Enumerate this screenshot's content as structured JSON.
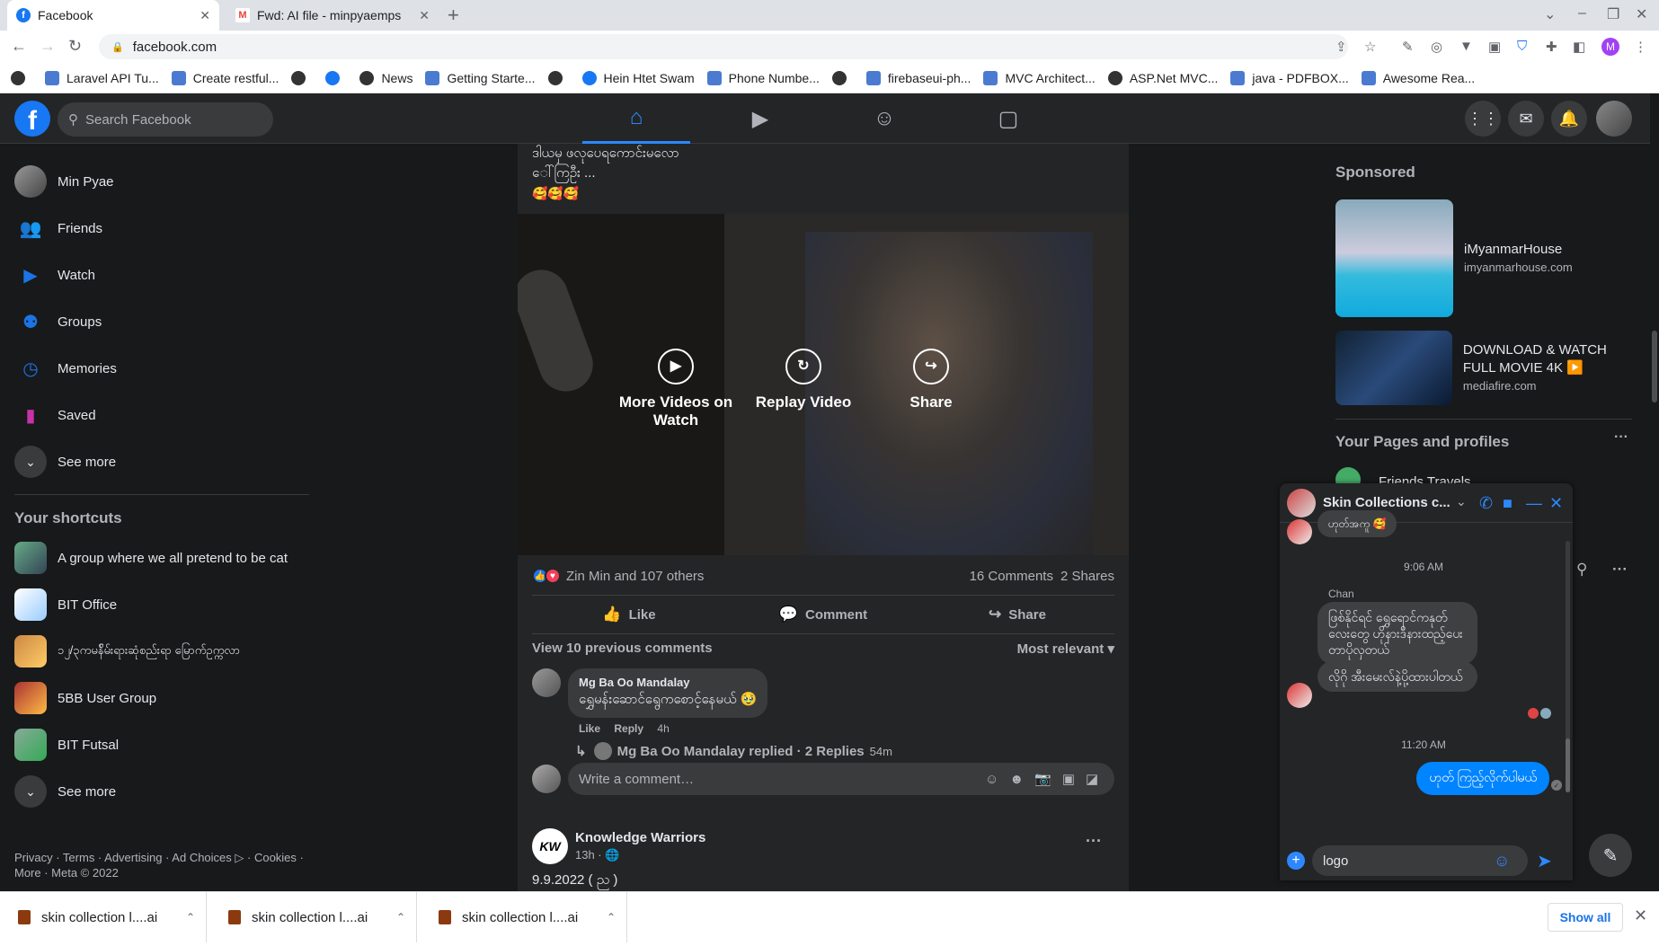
{
  "browser": {
    "tabs": [
      {
        "title": "Facebook",
        "active": true
      },
      {
        "title": "Fwd: AI file - minpyaemps",
        "active": false
      }
    ],
    "url": "facebook.com",
    "profile_initial": "M",
    "bookmarks": [
      {
        "label": "",
        "icon": "github-icon"
      },
      {
        "label": "Laravel API Tu...",
        "icon": "bookmark-icon"
      },
      {
        "label": "Create restful...",
        "icon": "bookmark-icon"
      },
      {
        "label": "",
        "icon": "github-icon"
      },
      {
        "label": "",
        "icon": "facebook-icon"
      },
      {
        "label": "News",
        "icon": "github-icon"
      },
      {
        "label": "Getting Starte...",
        "icon": "bookmark-icon"
      },
      {
        "label": "",
        "icon": "github-icon"
      },
      {
        "label": "Hein Htet Swam",
        "icon": "facebook-icon"
      },
      {
        "label": "Phone Numbe...",
        "icon": "bookmark-icon"
      },
      {
        "label": "",
        "icon": "github-icon"
      },
      {
        "label": "firebaseui-ph...",
        "icon": "bookmark-icon"
      },
      {
        "label": "MVC Architect...",
        "icon": "bookmark-icon"
      },
      {
        "label": "ASP.Net MVC...",
        "icon": "github-icon"
      },
      {
        "label": "java - PDFBOX...",
        "icon": "bookmark-icon"
      },
      {
        "label": "Awesome Rea...",
        "icon": "bookmark-icon"
      }
    ]
  },
  "header": {
    "logo": "f",
    "search_placeholder": "Search Facebook"
  },
  "leftnav": {
    "items": [
      {
        "label": "Min Pyae"
      },
      {
        "label": "Friends"
      },
      {
        "label": "Watch"
      },
      {
        "label": "Groups"
      },
      {
        "label": "Memories"
      },
      {
        "label": "Saved"
      },
      {
        "label": "See more"
      }
    ],
    "shortcuts_title": "Your shortcuts",
    "shortcuts": [
      {
        "label": "A group where we all pretend to be cat"
      },
      {
        "label": "BIT Office"
      },
      {
        "label": "၁၂/၃ကမန်ိမ်းရားဆုံစည်းရာ မြောက်ဥက္ကလာ"
      },
      {
        "label": "5BB User Group"
      },
      {
        "label": "BIT Futsal"
      },
      {
        "label": "See more"
      }
    ],
    "footer": "Privacy · Terms · Advertising · Ad Choices ▷ · Cookies · More · Meta © 2022"
  },
  "post": {
    "text_line1": "ဒါယမှ ဖလုပေရကောင်းမလော",
    "text_line2": "ေါ်ကြဦး ...",
    "emojis": "🥰🥰🥰",
    "video_buttons": [
      {
        "label": "More Videos on Watch"
      },
      {
        "label": "Replay Video"
      },
      {
        "label": "Share"
      }
    ],
    "reactions_text": "Zin Min and 107 others",
    "comments_count": "16 Comments",
    "shares_count": "2 Shares",
    "actions": {
      "like": "Like",
      "comment": "Comment",
      "share": "Share"
    },
    "view_previous": "View 10 previous comments",
    "sort": "Most relevant",
    "comment": {
      "author": "Mg Ba Oo Mandalay",
      "text": "ရွှေမန်းဆောင်ရွေကစောင့်နေမယ် 🥹",
      "like": "Like",
      "reply": "Reply",
      "time": "4h",
      "replies": "Mg Ba Oo Mandalay replied · 2 Replies",
      "replies_time": "54m"
    },
    "write_placeholder": "Write a comment…"
  },
  "post2": {
    "logo": "KW",
    "author": "Knowledge Warriors",
    "time": "13h ·",
    "text": "9.9.2022 ( ည )"
  },
  "right": {
    "sponsored_title": "Sponsored",
    "ads": [
      {
        "title": "iMyanmarHouse",
        "site": "imyanmarhouse.com"
      },
      {
        "title": "DOWNLOAD & WATCH FULL MOVIE 4K ▶️",
        "site": "mediafire.com"
      }
    ],
    "pages_title": "Your Pages and profiles",
    "pages_partial": "Friends Travels"
  },
  "chat": {
    "title": "Skin Collections c...",
    "top_partial": "ဟုတ်အကူ 🥰",
    "time1": "9:06 AM",
    "sender": "Chan",
    "msg1": "ဖြစ်နိုင်ရင် ရွှေရောင်ကနုတ်လေးတွေ ဟိုနားဒီနားထည့်ပေးတာပိုလှတယ်",
    "msg2": "လိုဂို အီးမေးလ်နဲ့ပို့ထားပါတယ်",
    "time2": "11:20 AM",
    "my_msg": "ဟုတ် ကြည့်လိုက်ပါမယ်",
    "input_value": "logo"
  },
  "downloads": {
    "items": [
      {
        "name": "skin collection l....ai"
      },
      {
        "name": "skin collection l....ai"
      },
      {
        "name": "skin collection l....ai"
      }
    ],
    "show_all": "Show all"
  },
  "colors": {
    "fb_blue": "#1877f2",
    "dark_bg": "#18191a",
    "card_bg": "#242526",
    "messenger_blue": "#0084ff"
  }
}
